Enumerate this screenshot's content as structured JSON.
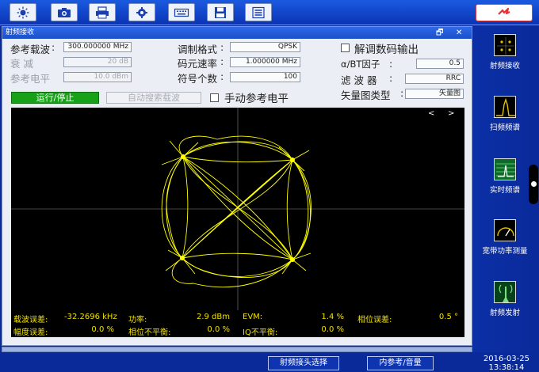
{
  "toolbar": {
    "buttons": [
      "brightness-icon",
      "camera-icon",
      "print-icon",
      "settings-icon",
      "keyboard-icon",
      "save-icon",
      "menu-icon"
    ],
    "alarm_icon": "lightning-icon"
  },
  "window": {
    "title": "射频接收",
    "restore_glyph": "🗗",
    "close_glyph": "✕"
  },
  "params": {
    "ref_carrier_label": "参考载波",
    "ref_carrier_value": "300.000000 MHz",
    "attenuation_label": "衰  减",
    "attenuation_value": "20 dB",
    "ref_level_label": "参考电平",
    "ref_level_value": "10.0 dBm",
    "modulation_label": "调制格式",
    "modulation_value": "QPSK",
    "symbol_rate_label": "码元速率",
    "symbol_rate_value": "1.000000 MHz",
    "symbol_count_label": "符号个数",
    "symbol_count_value": "100",
    "debug_output_label": "解调数码输出",
    "alpha_label": "α/BT因子",
    "alpha_value": "0.5",
    "filter_label": "滤 波 器",
    "filter_value": "RRC",
    "vector_type_label": "矢量图类型",
    "vector_type_value": "矢量图",
    "manual_ref_label": "手动参考电平",
    "run_stop": "运行/停止",
    "auto_search": "自动搜索载波"
  },
  "plot": {
    "prev": "<",
    "next": ">"
  },
  "measurements": {
    "carrier_err_label": "载波误差:",
    "carrier_err_value": "-32.2696 kHz",
    "power_label": "功率:",
    "power_value": "2.9 dBm",
    "evm_label": "EVM:",
    "evm_value": "1.4 %",
    "phase_err_label": "相位误差:",
    "phase_err_value": "0.5 °",
    "amp_err_label": "幅度误差:",
    "amp_err_value": "0.0 %",
    "phase_imb_label": "相位不平衡:",
    "phase_imb_value": "0.0 %",
    "iq_imb_label": "IQ不平衡:",
    "iq_imb_value": "0.0 %"
  },
  "status": {
    "rf_connector": "射频接头选择",
    "int_ref": "内参考/音量",
    "date": "2016-03-25",
    "time": "13:38:14"
  },
  "sidebar": {
    "items": [
      "射频接收",
      "扫频频谱",
      "实时频谱",
      "宽带功率测量",
      "射频发射"
    ]
  },
  "colors": {
    "trace": "#ffff00",
    "background": "#0a2a9a",
    "run_button": "#16a116"
  }
}
